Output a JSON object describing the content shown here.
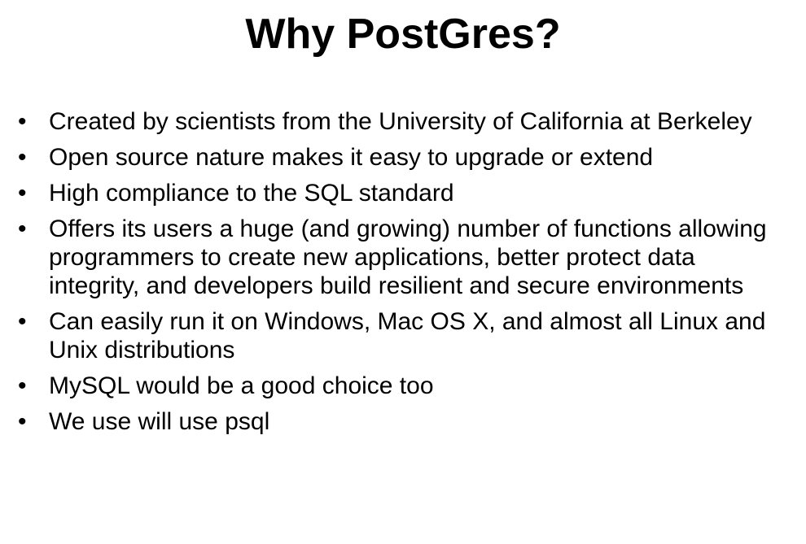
{
  "slide": {
    "title": "Why PostGres?",
    "bullet_glyph": "•",
    "bullets": [
      "Created by scientists from the University of California at Berkeley",
      "Open source nature makes it easy to upgrade or extend",
      "High compliance to the SQL standard",
      "Offers its users a huge (and growing) number of functions allowing programmers to create new applications, better protect data integrity, and developers build resilient and secure environments",
      "Can easily run it on Windows, Mac OS X, and almost all Linux and Unix distributions",
      "MySQL would be a good choice too",
      "We use will use psql"
    ]
  }
}
